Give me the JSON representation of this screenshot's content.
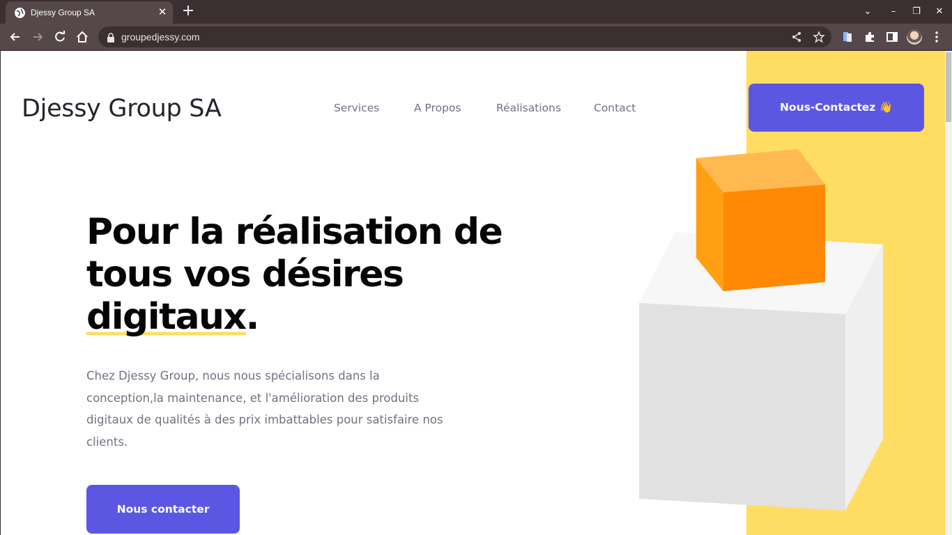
{
  "browser": {
    "tab_title": "Djessy Group SA",
    "tab_close": "✕",
    "new_tab": "+",
    "url": "groupedjessy.com",
    "window_controls": {
      "dropdown": "⌄",
      "minimize": "–",
      "restore": "❐",
      "close": "✕"
    },
    "icons": [
      "globe-icon",
      "back-icon",
      "forward-icon",
      "reload-icon",
      "home-icon",
      "lock-icon",
      "share-icon",
      "star-icon",
      "extension-tab-icon",
      "puzzle-icon",
      "sidebar-icon",
      "avatar",
      "menu-icon"
    ]
  },
  "header": {
    "logo": "Djessy Group SA",
    "nav": [
      {
        "label": "Services"
      },
      {
        "label": "A Propos"
      },
      {
        "label": "Réalisations"
      },
      {
        "label": "Contact"
      }
    ],
    "cta": "Nous-Contactez 👋"
  },
  "hero": {
    "title_line1": "Pour la réalisation de",
    "title_line2": "tous vos désires",
    "title_line3_word": "digitaux",
    "title_line3_punct": ".",
    "description": "Chez Djessy Group, nous nous spécialisons dans la conception,la maintenance, et l'amélioration des produits digitaux de qualités à des prix imbattables pour satisfaire nos clients.",
    "cta": "Nous contacter"
  },
  "colors": {
    "accent": "#5b57e3",
    "yellow": "#ffdd63",
    "orange_cube": "#ff8904",
    "chrome_dark": "#3c2f32",
    "chrome_mid": "#55474a"
  }
}
